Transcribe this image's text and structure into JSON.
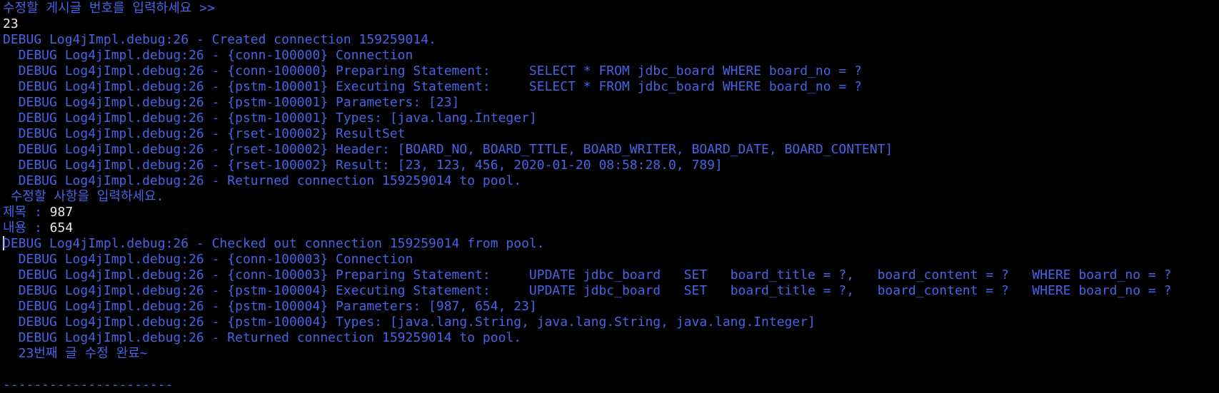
{
  "console": {
    "lines": [
      {
        "text": "수정할 게시글 번호를 입력하세요 >>",
        "color": "#4763e6"
      },
      {
        "text": "23",
        "color": "#e8e8e8"
      },
      {
        "text": "DEBUG Log4jImpl.debug:26 - Created connection 159259014.",
        "color": "#4763e6"
      },
      {
        "text": "  DEBUG Log4jImpl.debug:26 - {conn-100000} Connection",
        "color": "#4763e6"
      },
      {
        "text": "  DEBUG Log4jImpl.debug:26 - {conn-100000} Preparing Statement:     SELECT * FROM jdbc_board WHERE board_no = ?",
        "color": "#4763e6"
      },
      {
        "text": "  DEBUG Log4jImpl.debug:26 - {pstm-100001} Executing Statement:     SELECT * FROM jdbc_board WHERE board_no = ?",
        "color": "#4763e6"
      },
      {
        "text": "  DEBUG Log4jImpl.debug:26 - {pstm-100001} Parameters: [23]",
        "color": "#4763e6"
      },
      {
        "text": "  DEBUG Log4jImpl.debug:26 - {pstm-100001} Types: [java.lang.Integer]",
        "color": "#4763e6"
      },
      {
        "text": "  DEBUG Log4jImpl.debug:26 - {rset-100002} ResultSet",
        "color": "#4763e6"
      },
      {
        "text": "  DEBUG Log4jImpl.debug:26 - {rset-100002} Header: [BOARD_NO, BOARD_TITLE, BOARD_WRITER, BOARD_DATE, BOARD_CONTENT]",
        "color": "#4763e6"
      },
      {
        "text": "  DEBUG Log4jImpl.debug:26 - {rset-100002} Result: [23, 123, 456, 2020-01-20 08:58:28.0, 789]",
        "color": "#4763e6"
      },
      {
        "text": "  DEBUG Log4jImpl.debug:26 - Returned connection 159259014 to pool.",
        "color": "#4763e6"
      },
      {
        "text": " 수정할 사항을 입력하세요.",
        "color": "#4763e6"
      },
      {
        "parts": [
          {
            "text": "제목 : ",
            "color": "#4763e6"
          },
          {
            "text": "987",
            "color": "#e8e8e8"
          }
        ]
      },
      {
        "parts": [
          {
            "text": "내용 : ",
            "color": "#4763e6"
          },
          {
            "text": "654",
            "color": "#e8e8e8"
          }
        ]
      },
      {
        "text": "DEBUG Log4jImpl.debug:26 - Checked out connection 159259014 from pool.",
        "color": "#4763e6",
        "cursor": true
      },
      {
        "text": "  DEBUG Log4jImpl.debug:26 - {conn-100003} Connection",
        "color": "#4763e6"
      },
      {
        "text": "  DEBUG Log4jImpl.debug:26 - {conn-100003} Preparing Statement:     UPDATE jdbc_board   SET   board_title = ?,   board_content = ?   WHERE board_no = ?",
        "color": "#4763e6"
      },
      {
        "text": "  DEBUG Log4jImpl.debug:26 - {pstm-100004} Executing Statement:     UPDATE jdbc_board   SET   board_title = ?,   board_content = ?   WHERE board_no = ?",
        "color": "#4763e6"
      },
      {
        "text": "  DEBUG Log4jImpl.debug:26 - {pstm-100004} Parameters: [987, 654, 23]",
        "color": "#4763e6"
      },
      {
        "text": "  DEBUG Log4jImpl.debug:26 - {pstm-100004} Types: [java.lang.String, java.lang.String, java.lang.Integer]",
        "color": "#4763e6"
      },
      {
        "text": "  DEBUG Log4jImpl.debug:26 - Returned connection 159259014 to pool.",
        "color": "#4763e6"
      },
      {
        "text": "  23번째 글 수정 완료~",
        "color": "#4763e6"
      },
      {
        "text": "",
        "color": "#4763e6"
      },
      {
        "text": "----------------------",
        "color": "#4763e6"
      }
    ]
  }
}
